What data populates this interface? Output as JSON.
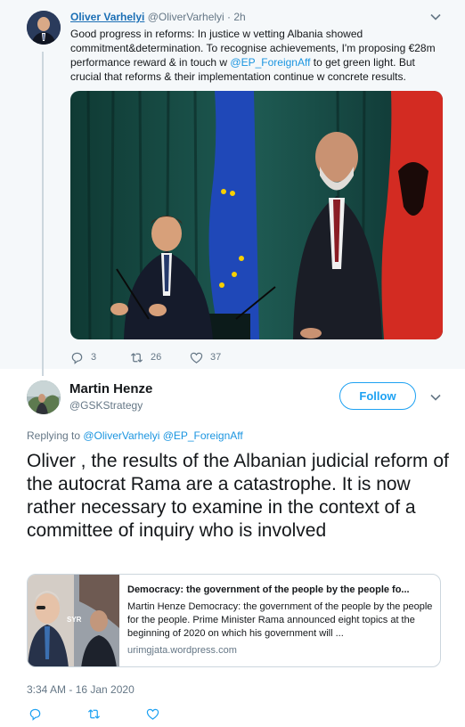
{
  "parent_tweet": {
    "display_name": "Oliver Varhelyi",
    "handle_time": "@OliverVarhelyi · 2h",
    "text_before": "Good progress in reforms: In justice w vetting Albania showed commitment&determination. To recognise achievements, I'm proposing €28m performance reward & in touch w ",
    "mention": "@EP_ForeignAff",
    "text_after": " to get green light. But crucial that reforms & their implementation continue w concrete results.",
    "reply_count": "3",
    "retweet_count": "26",
    "like_count": "37"
  },
  "main_tweet": {
    "display_name": "Martin Henze",
    "handle": "@GSKStrategy",
    "follow_label": "Follow",
    "replying_label": "Replying to ",
    "replying_mentions": "@OliverVarhelyi @EP_ForeignAff",
    "text": "Oliver , the results of the Albanian judicial reform of the autocrat Rama are a catastrophe. It is now rather necessary to examine in the context of a committee of inquiry who is involved",
    "timestamp": "3:34 AM - 16 Jan 2020"
  },
  "link_card": {
    "title": "Democracy: the government of the people by the people fo...",
    "description": "Martin Henze Democracy: the government of the people by the people for the people. Prime Minister Rama announced eight topics at the beginning of 2020 on which his government will ...",
    "domain": "urimgjata.wordpress.com",
    "image_caption": "SYR"
  },
  "icons": [
    "chevron-down-icon",
    "reply-icon",
    "retweet-icon",
    "like-icon"
  ],
  "colors": {
    "link": "#1b95e0",
    "follow": "#1da1f2",
    "muted": "#657786"
  }
}
